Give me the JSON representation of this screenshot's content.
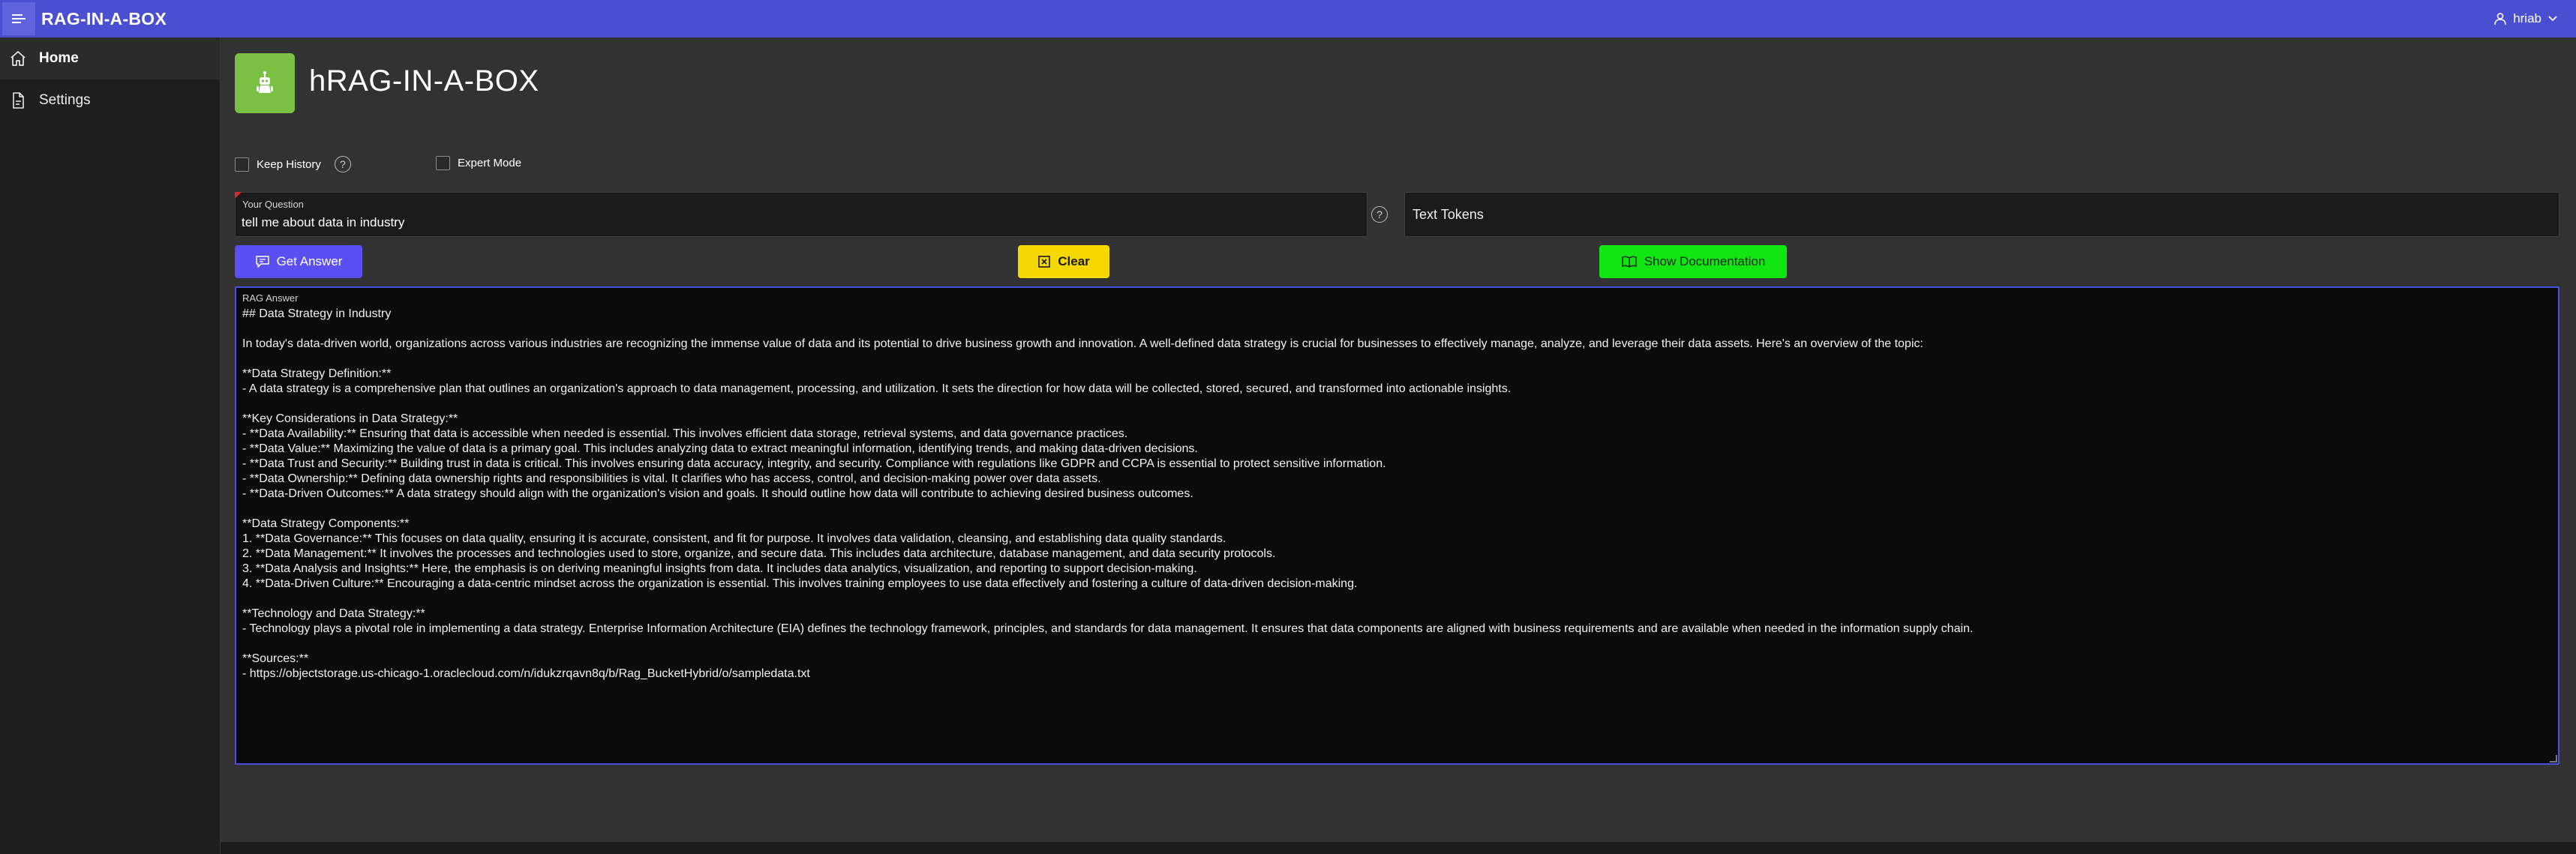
{
  "app": {
    "title": "RAG-IN-A-BOX",
    "user": "hriab"
  },
  "sidebar": {
    "items": [
      {
        "label": "Home",
        "icon": "home-icon",
        "active": true
      },
      {
        "label": "Settings",
        "icon": "document-icon",
        "active": false
      }
    ]
  },
  "page": {
    "title": "hRAG-IN-A-BOX",
    "logo_color": "#7ac143"
  },
  "options": {
    "keep_history_label": "Keep History",
    "expert_mode_label": "Expert Mode",
    "keep_history_checked": false,
    "expert_mode_checked": false,
    "help_glyph": "?"
  },
  "question": {
    "label": "Your Question",
    "value": "tell me about data in industry"
  },
  "tokens": {
    "value": "Text Tokens"
  },
  "buttons": {
    "get_answer": "Get Answer",
    "clear": "Clear",
    "show_documentation": "Show Documentation"
  },
  "answer": {
    "label": "RAG Answer",
    "text": "## Data Strategy in Industry\n\nIn today's data-driven world, organizations across various industries are recognizing the immense value of data and its potential to drive business growth and innovation. A well-defined data strategy is crucial for businesses to effectively manage, analyze, and leverage their data assets. Here's an overview of the topic:\n\n**Data Strategy Definition:**\n- A data strategy is a comprehensive plan that outlines an organization's approach to data management, processing, and utilization. It sets the direction for how data will be collected, stored, secured, and transformed into actionable insights.\n\n**Key Considerations in Data Strategy:**\n- **Data Availability:** Ensuring that data is accessible when needed is essential. This involves efficient data storage, retrieval systems, and data governance practices.\n- **Data Value:** Maximizing the value of data is a primary goal. This includes analyzing data to extract meaningful information, identifying trends, and making data-driven decisions.\n- **Data Trust and Security:** Building trust in data is critical. This involves ensuring data accuracy, integrity, and security. Compliance with regulations like GDPR and CCPA is essential to protect sensitive information.\n- **Data Ownership:** Defining data ownership rights and responsibilities is vital. It clarifies who has access, control, and decision-making power over data assets.\n- **Data-Driven Outcomes:** A data strategy should align with the organization's vision and goals. It should outline how data will contribute to achieving desired business outcomes.\n\n**Data Strategy Components:**\n1. **Data Governance:** This focuses on data quality, ensuring it is accurate, consistent, and fit for purpose. It involves data validation, cleansing, and establishing data quality standards.\n2. **Data Management:** It involves the processes and technologies used to store, organize, and secure data. This includes data architecture, database management, and data security protocols.\n3. **Data Analysis and Insights:** Here, the emphasis is on deriving meaningful insights from data. It includes data analytics, visualization, and reporting to support decision-making.\n4. **Data-Driven Culture:** Encouraging a data-centric mindset across the organization is essential. This involves training employees to use data effectively and fostering a culture of data-driven decision-making.\n\n**Technology and Data Strategy:**\n- Technology plays a pivotal role in implementing a data strategy. Enterprise Information Architecture (EIA) defines the technology framework, principles, and standards for data management. It ensures that data components are aligned with business requirements and are available when needed in the information supply chain.\n\n**Sources:**\n- https://objectstorage.us-chicago-1.oraclecloud.com/n/idukzrqavn8q/b/Rag_BucketHybrid/o/sampledata.txt"
  },
  "colors": {
    "topbar": "#4a4fd1",
    "get_answer": "#5a4ff0",
    "clear": "#f5d800",
    "documentation": "#12e612",
    "answer_border": "#4b4fe0"
  }
}
